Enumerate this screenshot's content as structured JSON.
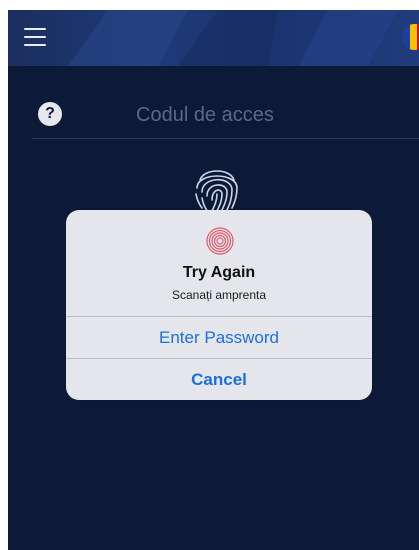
{
  "header": {
    "menu_icon": "hamburger-menu-icon",
    "flag_icon": "romanian-flag-icon"
  },
  "login": {
    "help_icon": "question-mark-icon",
    "help_glyph": "?",
    "access_code_placeholder": "Codul de acces",
    "fingerprint_icon": "fingerprint-icon"
  },
  "alert": {
    "icon": "fingerprint-icon",
    "title": "Try Again",
    "message": "Scanați amprenta",
    "enter_password_label": "Enter Password",
    "cancel_label": "Cancel"
  },
  "colors": {
    "background": "#0d1a37",
    "header": "#1f3a78",
    "alert_bg": "#e4e6ec",
    "link": "#1d6fdc",
    "fingerprint_alert": "#e05a6a"
  }
}
